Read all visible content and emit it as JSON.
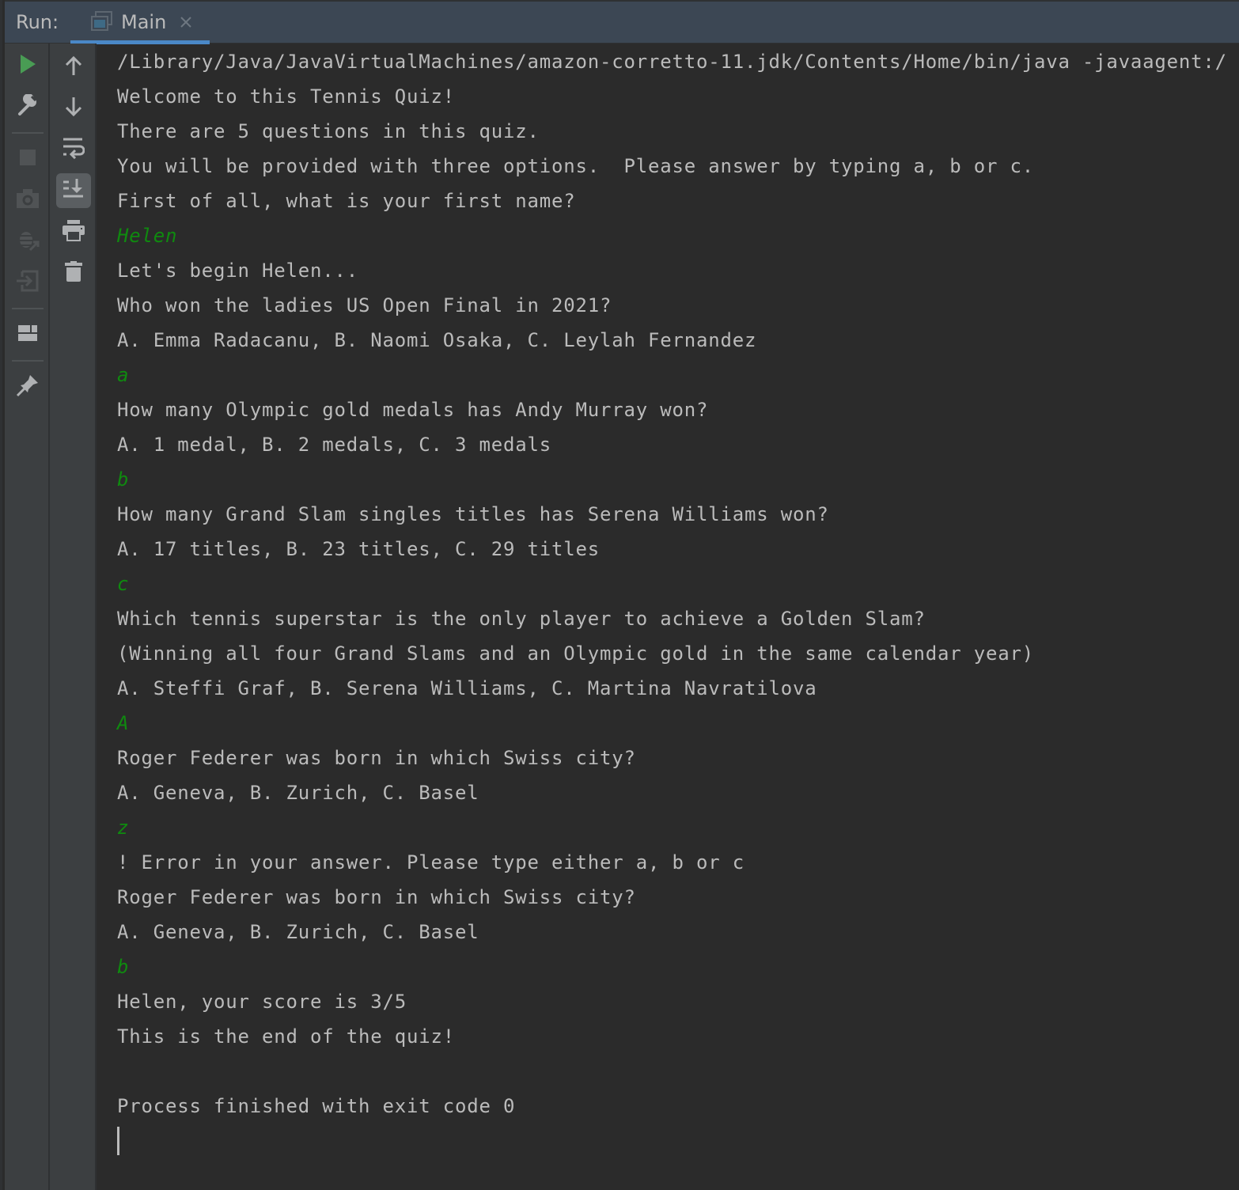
{
  "header": {
    "run_label": "Run:",
    "tab": {
      "label": "Main",
      "icon": "console-window-icon",
      "close_icon": "close-icon"
    },
    "accent_color": "#4a88c7"
  },
  "toolbar_left": [
    {
      "name": "rerun",
      "icon": "play-icon",
      "color": "#499c54"
    },
    {
      "name": "edit-configuration",
      "icon": "wrench-icon"
    },
    {
      "name": "stop",
      "icon": "stop-icon",
      "disabled": true
    },
    {
      "name": "dump-threads",
      "icon": "camera-icon",
      "disabled": true
    },
    {
      "name": "exit-debug",
      "icon": "bug-exit-icon",
      "disabled": true
    },
    {
      "name": "attach",
      "icon": "login-icon",
      "disabled": true
    },
    {
      "name": "restore-layout",
      "icon": "layout-icon"
    },
    {
      "name": "pin-tab",
      "icon": "pin-icon"
    }
  ],
  "toolbar_right": [
    {
      "name": "up-stack",
      "icon": "arrow-up-icon"
    },
    {
      "name": "down-stack",
      "icon": "arrow-down-icon"
    },
    {
      "name": "soft-wrap",
      "icon": "soft-wrap-icon"
    },
    {
      "name": "scroll-to-end",
      "icon": "scroll-to-end-icon",
      "active": true
    },
    {
      "name": "print",
      "icon": "printer-icon"
    },
    {
      "name": "clear-all",
      "icon": "trash-icon"
    }
  ],
  "console": {
    "output_color": "#bbbbbb",
    "input_color": "#0f8a0f",
    "lines": [
      {
        "text": "/Library/Java/JavaVirtualMachines/amazon-corretto-11.jdk/Contents/Home/bin/java -javaagent:/",
        "type": "output"
      },
      {
        "text": "Welcome to this Tennis Quiz!",
        "type": "output"
      },
      {
        "text": "There are 5 questions in this quiz.",
        "type": "output"
      },
      {
        "text": "You will be provided with three options.  Please answer by typing a, b or c.",
        "type": "output"
      },
      {
        "text": "First of all, what is your first name?",
        "type": "output"
      },
      {
        "text": "Helen",
        "type": "input"
      },
      {
        "text": "Let's begin Helen...",
        "type": "output"
      },
      {
        "text": "Who won the ladies US Open Final in 2021?",
        "type": "output"
      },
      {
        "text": "A. Emma Radacanu, B. Naomi Osaka, C. Leylah Fernandez",
        "type": "output"
      },
      {
        "text": "a",
        "type": "input"
      },
      {
        "text": "How many Olympic gold medals has Andy Murray won?",
        "type": "output"
      },
      {
        "text": "A. 1 medal, B. 2 medals, C. 3 medals",
        "type": "output"
      },
      {
        "text": "b",
        "type": "input"
      },
      {
        "text": "How many Grand Slam singles titles has Serena Williams won?",
        "type": "output"
      },
      {
        "text": "A. 17 titles, B. 23 titles, C. 29 titles",
        "type": "output"
      },
      {
        "text": "c",
        "type": "input"
      },
      {
        "text": "Which tennis superstar is the only player to achieve a Golden Slam?",
        "type": "output"
      },
      {
        "text": "(Winning all four Grand Slams and an Olympic gold in the same calendar year)",
        "type": "output"
      },
      {
        "text": "A. Steffi Graf, B. Serena Williams, C. Martina Navratilova",
        "type": "output"
      },
      {
        "text": "A",
        "type": "input"
      },
      {
        "text": "Roger Federer was born in which Swiss city?",
        "type": "output"
      },
      {
        "text": "A. Geneva, B. Zurich, C. Basel",
        "type": "output"
      },
      {
        "text": "z",
        "type": "input"
      },
      {
        "text": "! Error in your answer. Please type either a, b or c",
        "type": "output"
      },
      {
        "text": "Roger Federer was born in which Swiss city?",
        "type": "output"
      },
      {
        "text": "A. Geneva, B. Zurich, C. Basel",
        "type": "output"
      },
      {
        "text": "b",
        "type": "input"
      },
      {
        "text": "Helen, your score is 3/5",
        "type": "output"
      },
      {
        "text": "This is the end of the quiz!",
        "type": "output"
      },
      {
        "text": "",
        "type": "output"
      },
      {
        "text": "Process finished with exit code 0",
        "type": "output"
      }
    ]
  }
}
